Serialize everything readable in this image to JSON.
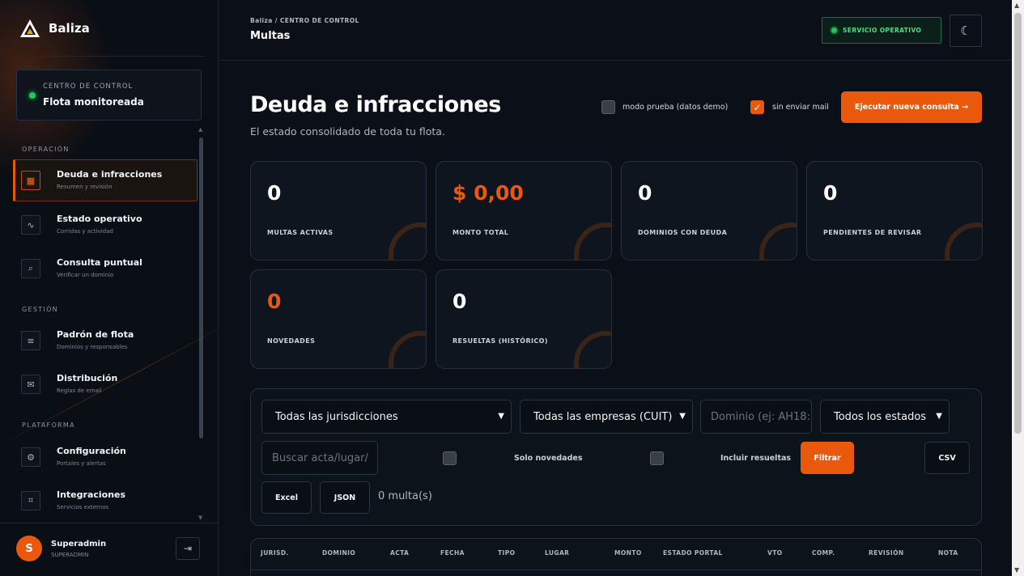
{
  "brand": {
    "name": "Baliza",
    "accent": "#ea580c"
  },
  "control_center": {
    "kicker": "CENTRO DE CONTROL",
    "title": "Flota monitoreada"
  },
  "sidebar": {
    "sections": [
      {
        "label": "OPERACIÓN"
      },
      {
        "label": "GESTIÓN"
      },
      {
        "label": "PLATAFORMA"
      }
    ],
    "items": [
      {
        "title": "Deuda e infracciones",
        "sub": "Resumen y revisión",
        "icon": "dashboard-icon",
        "glyph": "▦",
        "active": true
      },
      {
        "title": "Estado operativo",
        "sub": "Corridas y actividad",
        "icon": "activity-icon",
        "glyph": "∿",
        "active": false
      },
      {
        "title": "Consulta puntual",
        "sub": "Verificar un dominio",
        "icon": "search-icon",
        "glyph": "⌕",
        "active": false
      },
      {
        "title": "Padrón de flota",
        "sub": "Dominios y responsables",
        "icon": "list-icon",
        "glyph": "≡",
        "active": false
      },
      {
        "title": "Distribución",
        "sub": "Reglas de email",
        "icon": "mail-icon",
        "glyph": "✉",
        "active": false
      },
      {
        "title": "Configuración",
        "sub": "Portales y alertas",
        "icon": "gear-icon",
        "glyph": "⚙",
        "active": false
      },
      {
        "title": "Integraciones",
        "sub": "Servicios externos",
        "icon": "integration-icon",
        "glyph": "⌗",
        "active": false
      }
    ]
  },
  "user": {
    "initial": "S",
    "name": "Superadmin",
    "role": "SUPERADMIN",
    "logout_glyph": "⇥"
  },
  "header": {
    "breadcrumb": "Baliza / CENTRO DE CONTROL",
    "title": "Multas",
    "status": "SERVICIO OPERATIVO",
    "theme_glyph": "☾"
  },
  "main": {
    "title": "Deuda e infracciones",
    "lead": "El estado consolidado de toda tu flota.",
    "demo_label": "modo prueba (datos demo)",
    "nomail_label": "sin enviar mail",
    "run_label": "Ejecutar nueva consulta →"
  },
  "stats": [
    {
      "value": "0",
      "label": "MULTAS ACTIVAS",
      "accent": false
    },
    {
      "value": "$ 0,00",
      "label": "MONTO TOTAL",
      "accent": true
    },
    {
      "value": "0",
      "label": "DOMINIOS CON DEUDA",
      "accent": false
    },
    {
      "value": "0",
      "label": "PENDIENTES DE REVISAR",
      "accent": false
    },
    {
      "value": "0",
      "label": "NOVEDADES",
      "accent": true
    },
    {
      "value": "0",
      "label": "RESUELTAS (HISTÓRICO)",
      "accent": false
    }
  ],
  "filters": {
    "jurisdiction": "Todas las jurisdicciones",
    "company": "Todas las empresas (CUIT)",
    "domain_placeholder": "Dominio (ej: AH18:",
    "status": "Todos los estados",
    "search_placeholder": "Buscar acta/lugar/",
    "only_news": "Solo novedades",
    "include_resolved": "Incluir resueltas",
    "filter_btn": "Filtrar",
    "csv_btn": "CSV",
    "excel_btn": "Excel",
    "json_btn": "JSON",
    "count": "0 multa(s)"
  },
  "table": {
    "columns": [
      "JURISD.",
      "DOMINIO",
      "ACTA",
      "FECHA",
      "TIPO",
      "LUGAR",
      "MONTO",
      "ESTADO PORTAL",
      "VTO",
      "COMP.",
      "REVISIÓN",
      "NOTA"
    ]
  }
}
